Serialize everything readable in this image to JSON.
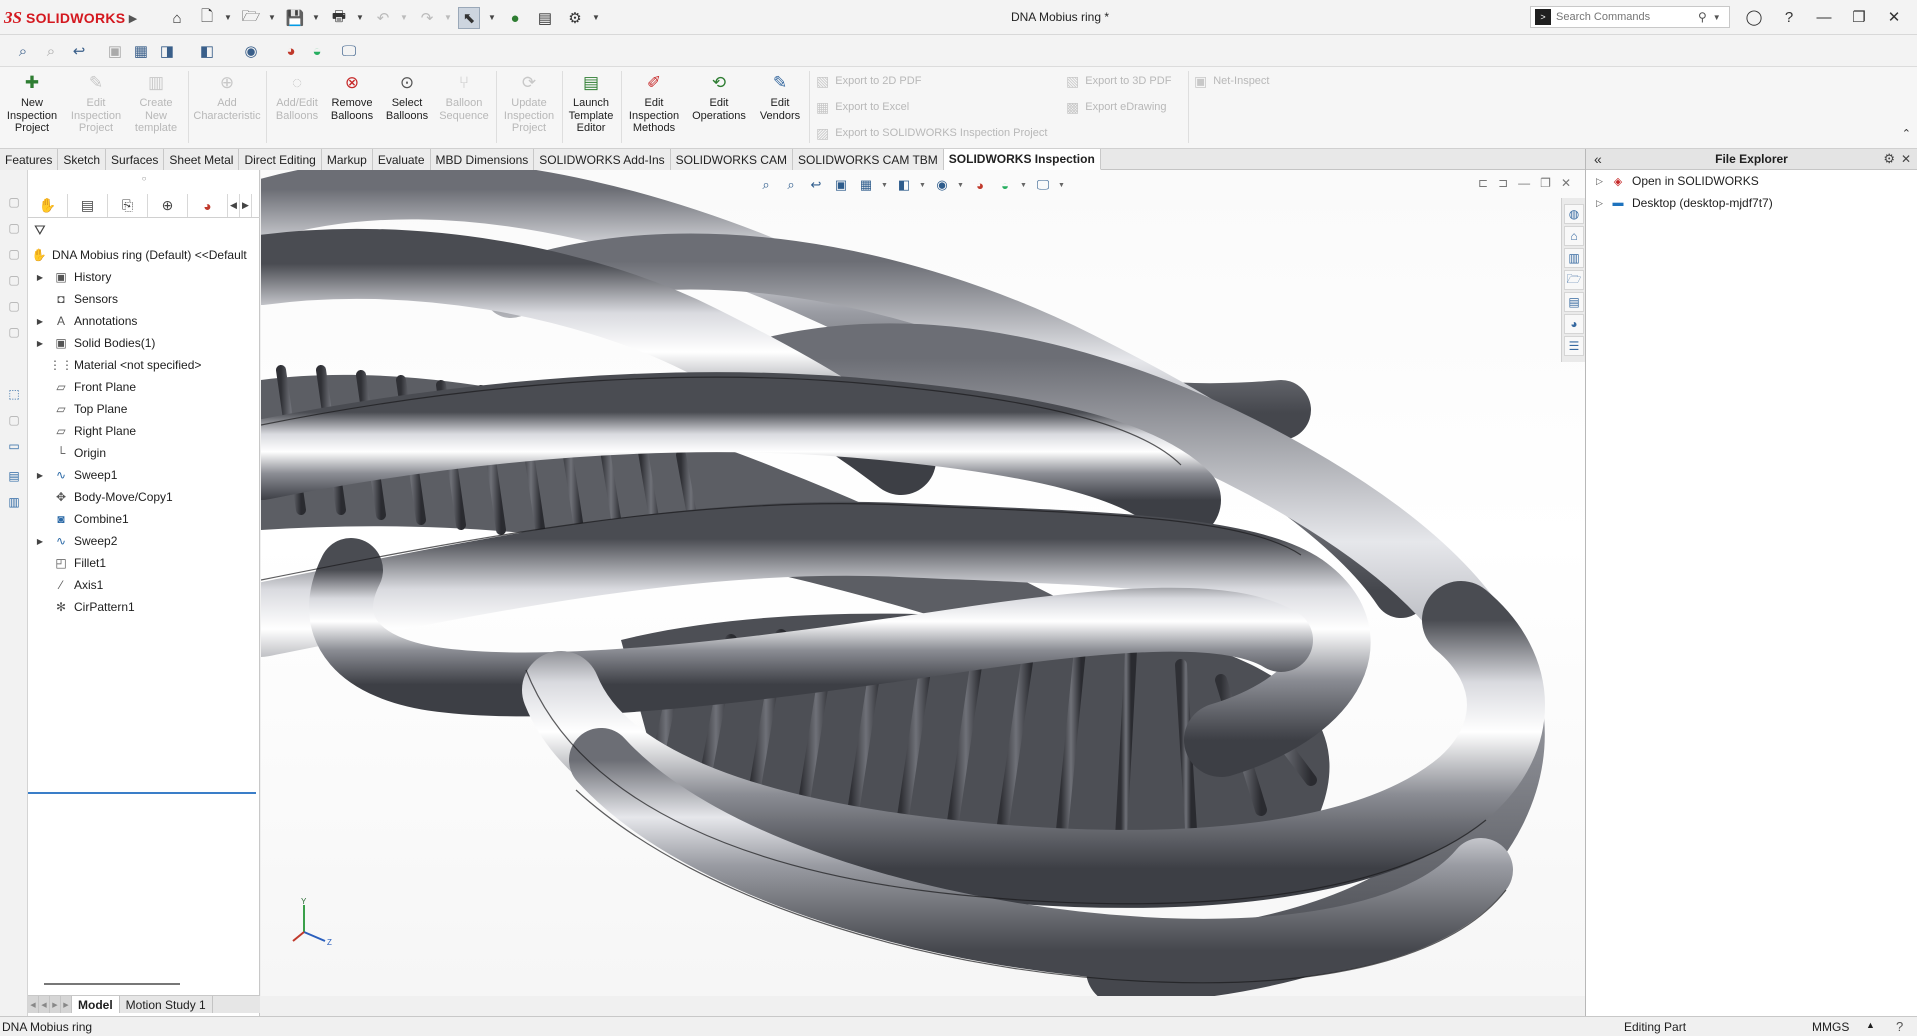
{
  "app": {
    "brand_ds": "3S",
    "brand_name": "SOLIDWORKS",
    "document_title": "DNA Mobius ring *"
  },
  "search": {
    "placeholder": "Search Commands"
  },
  "ribbon": {
    "buttons": [
      {
        "label": "New Inspection Project",
        "icon": "new-inspection-project-icon",
        "enabled": true
      },
      {
        "label": "Edit Inspection Project",
        "icon": "edit-inspection-project-icon",
        "enabled": false
      },
      {
        "label": "Create New template",
        "icon": "create-template-icon",
        "enabled": false
      },
      {
        "label": "Add Characteristic",
        "icon": "add-characteristic-icon",
        "enabled": false
      },
      {
        "label": "Add/Edit Balloons",
        "icon": "add-balloons-icon",
        "enabled": false
      },
      {
        "label": "Remove Balloons",
        "icon": "remove-balloons-icon",
        "enabled": true
      },
      {
        "label": "Select Balloons",
        "icon": "select-balloons-icon",
        "enabled": true
      },
      {
        "label": "Balloon Sequence",
        "icon": "balloon-sequence-icon",
        "enabled": false
      },
      {
        "label": "Update Inspection Project",
        "icon": "update-inspection-icon",
        "enabled": false
      },
      {
        "label": "Launch Template Editor",
        "icon": "template-editor-icon",
        "enabled": true
      },
      {
        "label": "Edit Inspection Methods",
        "icon": "inspection-methods-icon",
        "enabled": true
      },
      {
        "label": "Edit Operations",
        "icon": "edit-operations-icon",
        "enabled": true
      },
      {
        "label": "Edit Vendors",
        "icon": "edit-vendors-icon",
        "enabled": true
      }
    ],
    "exports_left": [
      "Export to 2D PDF",
      "Export to Excel",
      "Export to SOLIDWORKS Inspection Project"
    ],
    "exports_right": [
      "Export to 3D PDF",
      "Export eDrawing"
    ],
    "net_inspect": "Net-Inspect"
  },
  "tabs": [
    {
      "label": "Features",
      "active": false
    },
    {
      "label": "Sketch",
      "active": false
    },
    {
      "label": "Surfaces",
      "active": false
    },
    {
      "label": "Sheet Metal",
      "active": false
    },
    {
      "label": "Direct Editing",
      "active": false
    },
    {
      "label": "Markup",
      "active": false
    },
    {
      "label": "Evaluate",
      "active": false
    },
    {
      "label": "MBD Dimensions",
      "active": false
    },
    {
      "label": "SOLIDWORKS Add-Ins",
      "active": false
    },
    {
      "label": "SOLIDWORKS CAM",
      "active": false
    },
    {
      "label": "SOLIDWORKS CAM TBM",
      "active": false
    },
    {
      "label": "SOLIDWORKS Inspection",
      "active": true
    }
  ],
  "feature_tree": {
    "root": "DNA Mobius ring (Default) <<Default",
    "items": [
      {
        "label": "History",
        "icon": "history-folder-icon",
        "expandable": true
      },
      {
        "label": "Sensors",
        "icon": "sensors-folder-icon",
        "expandable": false
      },
      {
        "label": "Annotations",
        "icon": "annotations-folder-icon",
        "expandable": true
      },
      {
        "label": "Solid Bodies(1)",
        "icon": "solid-bodies-folder-icon",
        "expandable": true
      },
      {
        "label": "Material <not specified>",
        "icon": "material-icon",
        "expandable": false
      },
      {
        "label": "Front Plane",
        "icon": "plane-icon",
        "expandable": false
      },
      {
        "label": "Top Plane",
        "icon": "plane-icon",
        "expandable": false
      },
      {
        "label": "Right Plane",
        "icon": "plane-icon",
        "expandable": false
      },
      {
        "label": "Origin",
        "icon": "origin-icon",
        "expandable": false
      },
      {
        "label": "Sweep1",
        "icon": "sweep-icon",
        "expandable": true
      },
      {
        "label": "Body-Move/Copy1",
        "icon": "move-copy-icon",
        "expandable": false
      },
      {
        "label": "Combine1",
        "icon": "combine-icon",
        "expandable": false
      },
      {
        "label": "Sweep2",
        "icon": "sweep-icon",
        "expandable": true
      },
      {
        "label": "Fillet1",
        "icon": "fillet-icon",
        "expandable": false
      },
      {
        "label": "Axis1",
        "icon": "axis-icon",
        "expandable": false
      },
      {
        "label": "CirPattern1",
        "icon": "circular-pattern-icon",
        "expandable": false
      }
    ]
  },
  "model_tabs": [
    {
      "label": "Model",
      "active": true
    },
    {
      "label": "Motion Study 1",
      "active": false
    }
  ],
  "triad": {
    "y": "Y",
    "z": "Z"
  },
  "file_explorer": {
    "title": "File Explorer",
    "items": [
      {
        "label": "Open in SOLIDWORKS",
        "icon": "solidworks-file-icon"
      },
      {
        "label": "Desktop (desktop-mjdf7t7)",
        "icon": "desktop-folder-icon"
      }
    ]
  },
  "status": {
    "left": "DNA Mobius ring",
    "editing": "Editing Part",
    "units": "MMGS"
  },
  "colors": {
    "brand_red": "#d4181f",
    "accent_blue": "#3a7ec8",
    "model_metal": "#8e9097"
  }
}
